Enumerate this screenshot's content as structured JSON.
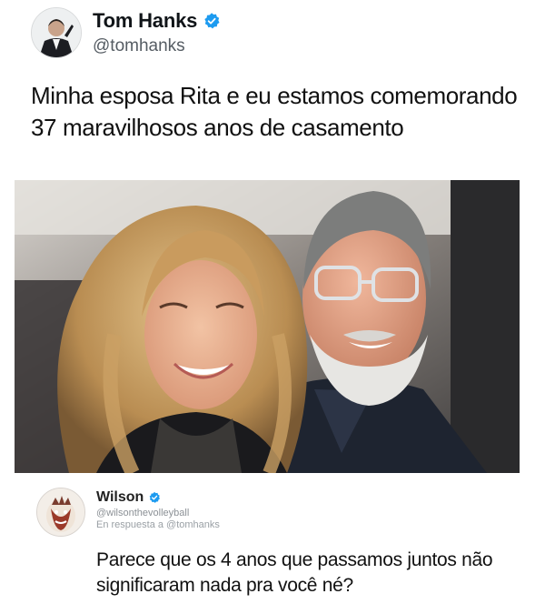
{
  "tweet": {
    "author_name": "Tom Hanks",
    "author_handle": "@tomhanks",
    "text": "Minha esposa Rita e eu estamos comemorando 37 maravilhosos anos de casamento",
    "verified_color": "#1d9bf0",
    "photo_icon": "photo-of-couple"
  },
  "reply": {
    "author_name": "Wilson",
    "author_handle": "@wilsonthevolleyball",
    "in_reply_to": "En respuesta a @tomhanks",
    "text": "Parece que os 4 anos que passamos juntos não significaram nada pra você né?",
    "verified_color": "#1d9bf0"
  }
}
